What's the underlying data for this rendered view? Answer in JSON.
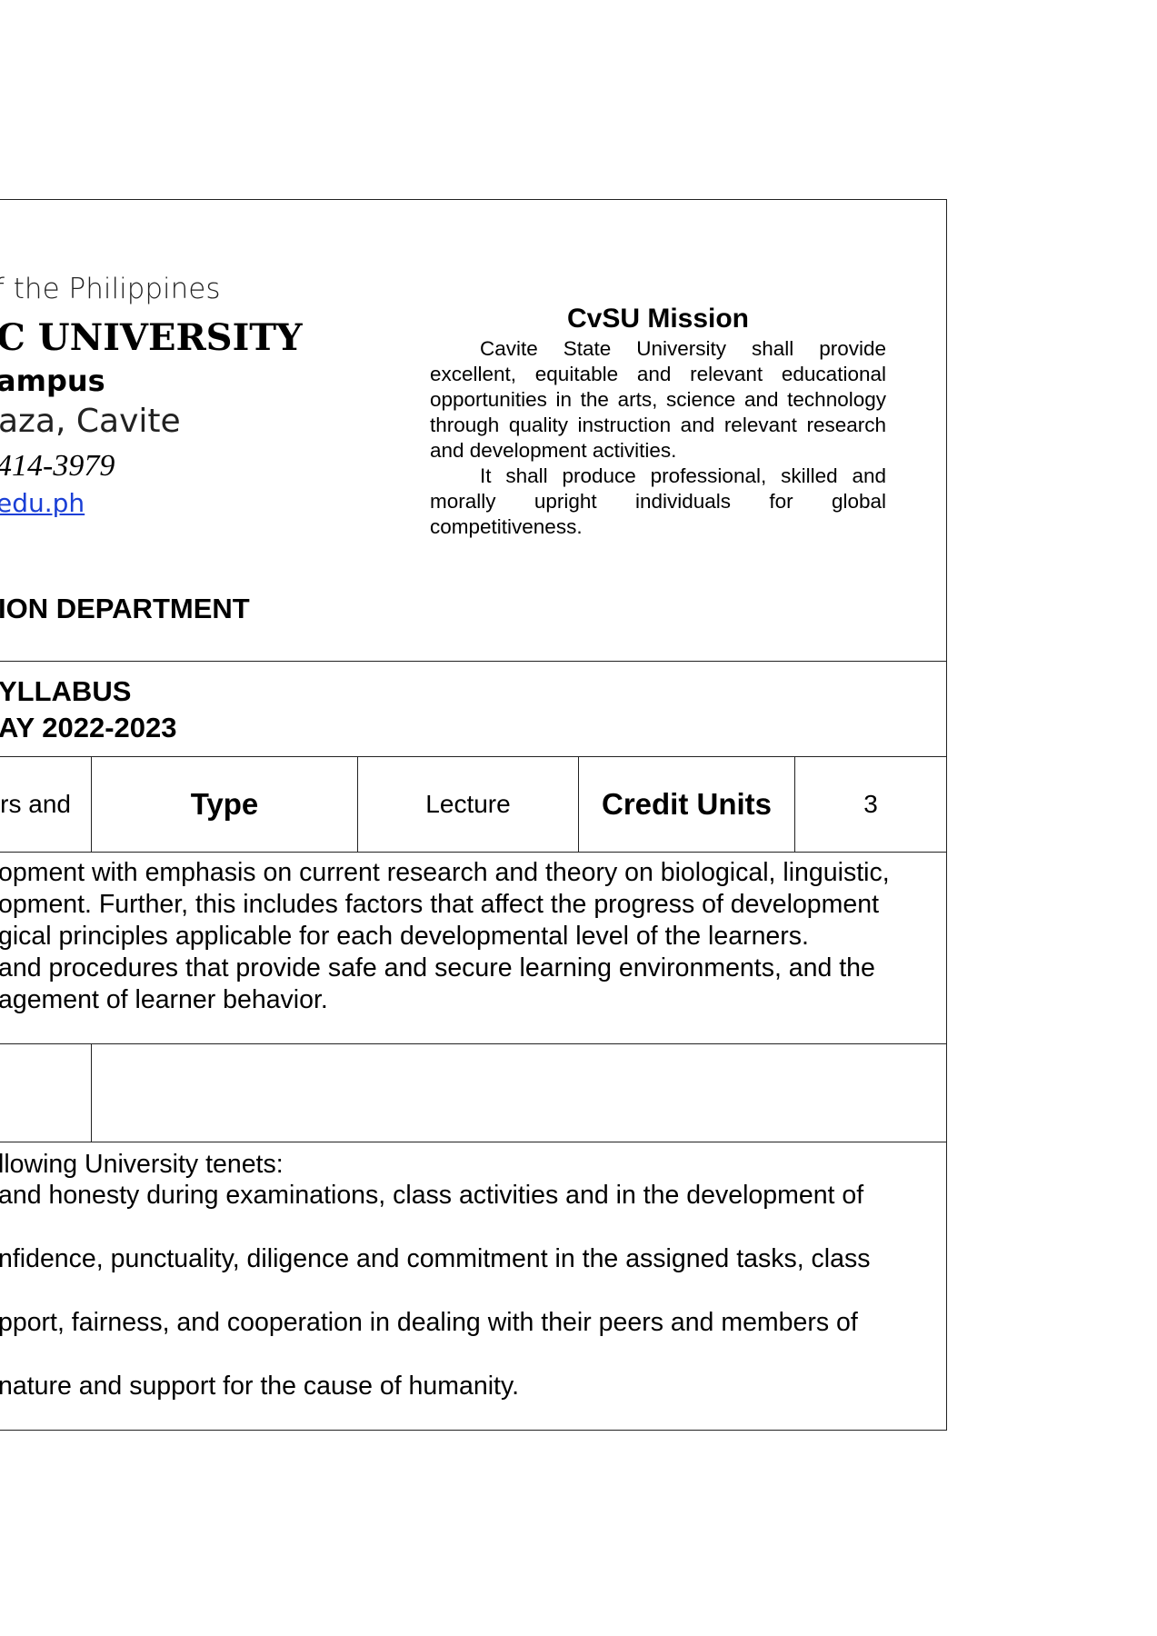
{
  "header": {
    "republic_line": "f the Philippines",
    "university_name": "C UNIVERSITY",
    "campus": "ampus",
    "location": "aza, Cavite",
    "phone": "414-3979",
    "website": "edu.ph",
    "department": "ION DEPARTMENT"
  },
  "mission": {
    "title": "CvSU Mission",
    "paragraphs": [
      "Cavite State University shall provide excellent, equitable and relevant educational opportunities in the arts, science and technology through quality instruction and relevant research and development activities.",
      "It shall produce professional, skilled and morally upright individuals for global competitiveness."
    ]
  },
  "syllabus": {
    "title": "YLLABUS",
    "academic_year": "AY 2022-2023"
  },
  "course_row": {
    "title_fragment": "rs and",
    "type_label": "Type",
    "type_value": "Lecture",
    "credit_label": "Credit Units",
    "credit_value": "3"
  },
  "description": {
    "lines": [
      "opment with emphasis on current research and theory on biological, linguistic,",
      "opment. Further, this includes factors that affect the progress of development",
      "gical principles applicable for each developmental level of the learners.",
      " and procedures that provide safe and secure learning environments, and the",
      "agement of learner behavior."
    ]
  },
  "tenets": {
    "lines": [
      "llowing University tenets:",
      " and honesty during examinations, class activities and in the development of",
      "nfidence, punctuality, diligence and commitment in the assigned tasks, class",
      "pport, fairness, and cooperation in dealing with their peers and members of",
      "nature and support for the cause of humanity."
    ]
  }
}
